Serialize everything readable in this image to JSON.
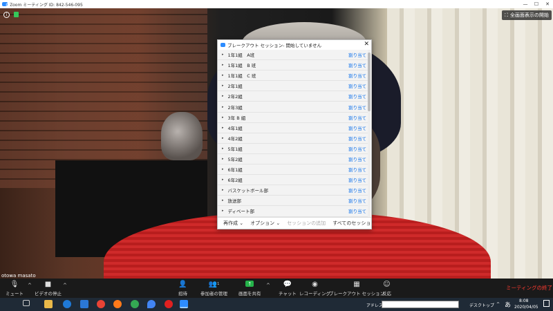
{
  "window": {
    "title": "Zoom ミーティング ID: 842-546-095",
    "minimize": "—",
    "maximize": "☐",
    "close": "✕"
  },
  "video": {
    "fullscreen_label": "全画面表示の開始",
    "participant_name": "otowa masato"
  },
  "breakout": {
    "title": "ブレークアウト セッション- 開始していません",
    "assign_label": "割り当て",
    "rooms": [
      "1年1組　A班",
      "1年1組　B 班",
      "1年1組　C 班",
      "2年1組",
      "2年2組",
      "2年3組",
      "3年 B 組",
      "4年1組",
      "4年2組",
      "5年1組",
      "5年2組",
      "6年1組",
      "6年2組",
      "バスケットボール部",
      "放送部",
      "ディベート部"
    ],
    "footer": {
      "recreate": "再作成",
      "options": "オプション",
      "add_session": "セッションの追加",
      "all_sessions": "すべてのセッション"
    }
  },
  "toolbar": {
    "mute": "ミュート",
    "video_stop": "ビデオの停止",
    "invite": "招待",
    "participants": "参加者の管理",
    "participant_count": "1",
    "share": "画面を共有",
    "chat": "チャット",
    "record": "レコーディング",
    "breakout": "ブレークアウト セッション",
    "reactions": "反応",
    "end": "ミーティングの終了"
  },
  "taskbar": {
    "address_label": "アドレス",
    "desktop_label": "デスクトップ",
    "ime": "あ",
    "time": "8:08",
    "date": "2020/04/05"
  }
}
